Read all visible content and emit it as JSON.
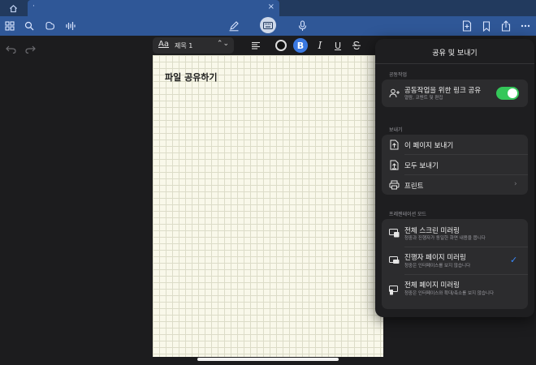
{
  "tabbar": {
    "tab_title": "·",
    "tab_close": "×"
  },
  "icons": {
    "home": "home-icon",
    "grid": "grid-icon",
    "search": "search-icon",
    "lasso": "lasso-icon",
    "audio": "audio-waveform-icon",
    "pen": "pen-icon",
    "keyboard": "keyboard-icon",
    "mic": "microphone-icon",
    "add_page": "add-page-icon",
    "bookmark": "bookmark-icon",
    "share": "share-icon",
    "more": "more-icon"
  },
  "format_bar": {
    "aa": "Aa",
    "style_name": "제목 1",
    "style_arrows": "⌃⌄",
    "bold": "B",
    "italic": "I",
    "underline": "U",
    "strike": "S"
  },
  "page": {
    "heading": "파일 공유하기"
  },
  "popover": {
    "title": "공유 및 보내기",
    "collab_header": "공동작업",
    "collab_label": "공동작업을 위한 링크 공유",
    "collab_sub": "열람, 코멘트 및 편집",
    "collab_enabled": true,
    "send_header": "보내기",
    "send_page": "이 페이지 보내기",
    "send_all": "모두 보내기",
    "print": "프린트",
    "chevron": "›",
    "present_header": "프레젠테이션 모드",
    "mode1_label": "전체 스크린 미러링",
    "mode1_sub": "청중과 진행자가 동일한 화면 내용을 봅니다",
    "mode2_label": "진행자 페이지 미러링",
    "mode2_sub": "청중은 인터페이스를 보지 않습니다",
    "mode3_label": "전체 페이지 미러링",
    "mode3_sub": "청중은 인터페이스와 확대/축소를 보지 않습니다",
    "selected_mark": "✓"
  },
  "colors": {
    "accent": "#3a78e0",
    "toolbar": "#2f5797",
    "toggle_on": "#34c759",
    "check": "#3a8bff"
  }
}
